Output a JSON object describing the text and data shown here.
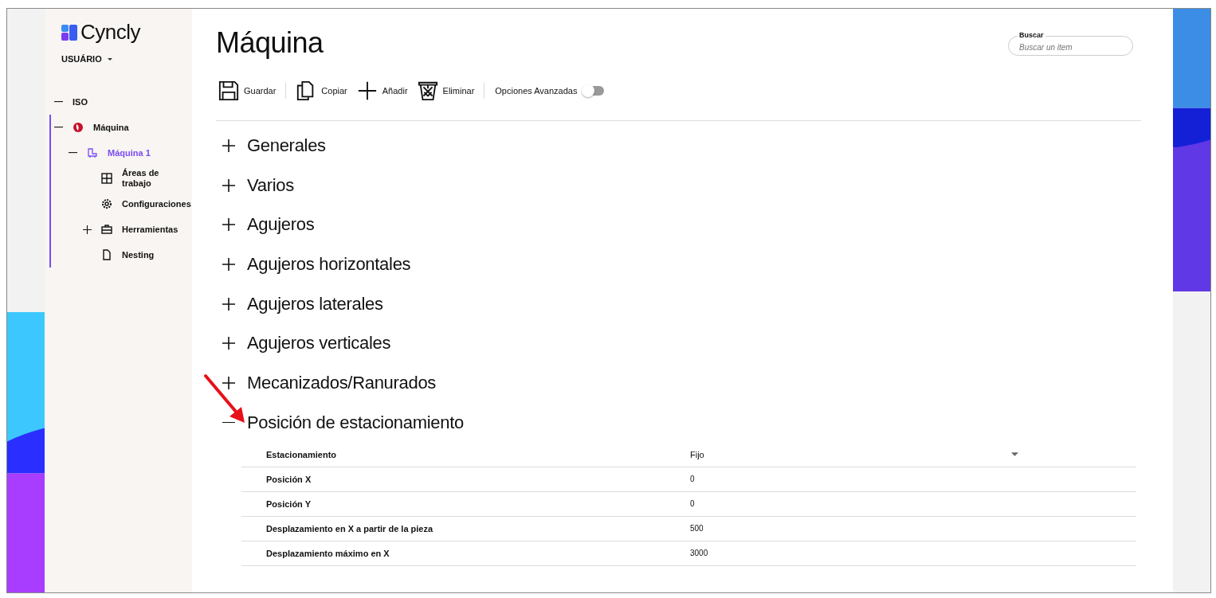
{
  "brand": {
    "name": "Cyncly"
  },
  "user_menu": {
    "label": "USUÁRIO"
  },
  "tree": [
    {
      "label": "ISO",
      "kind": "plain",
      "expanded": true,
      "selected": false
    },
    {
      "label": "Máquina",
      "kind": "brand",
      "expanded": true,
      "selected": false,
      "children": [
        {
          "label": "Máquina 1",
          "kind": "machine",
          "expanded": true,
          "selected": true,
          "children": [
            {
              "label": "Áreas de trabajo",
              "kind": "areas",
              "selected": false
            },
            {
              "label": "Configuraciones",
              "kind": "settings",
              "selected": false
            },
            {
              "label": "Herramientas",
              "kind": "tools",
              "expanded": false,
              "selected": false
            },
            {
              "label": "Nesting",
              "kind": "document",
              "selected": false
            }
          ]
        }
      ]
    }
  ],
  "page_title": "Máquina",
  "search": {
    "label": "Buscar",
    "placeholder": "Buscar un item"
  },
  "toolbar": [
    {
      "kind": "save",
      "label": "Guardar"
    },
    {
      "kind": "separator"
    },
    {
      "kind": "copy",
      "label": "Copiar"
    },
    {
      "kind": "add",
      "label": "Añadir"
    },
    {
      "kind": "delete",
      "label": "Eliminar"
    },
    {
      "kind": "separator"
    },
    {
      "kind": "toggle",
      "label": "Opciones Avanzadas",
      "on": false
    }
  ],
  "sections": [
    {
      "title": "Generales",
      "expanded": false
    },
    {
      "title": "Varios",
      "expanded": false
    },
    {
      "title": "Agujeros",
      "expanded": false
    },
    {
      "title": "Agujeros horizontales",
      "expanded": false
    },
    {
      "title": "Agujeros laterales",
      "expanded": false
    },
    {
      "title": "Agujeros verticales",
      "expanded": false
    },
    {
      "title": "Mecanizados/Ranurados",
      "expanded": false
    },
    {
      "title": "Posición de estacionamiento",
      "expanded": true,
      "rows": [
        {
          "label": "Estacionamiento",
          "value": "Fijo",
          "kind": "select"
        },
        {
          "label": "Posición X",
          "value": "0",
          "kind": "text"
        },
        {
          "label": "Posición Y",
          "value": "0",
          "kind": "text"
        },
        {
          "label": "Desplazamiento en X a partir de la pieza",
          "value": "500",
          "kind": "text"
        },
        {
          "label": "Desplazamiento máximo en X",
          "value": "3000",
          "kind": "text"
        }
      ]
    }
  ]
}
